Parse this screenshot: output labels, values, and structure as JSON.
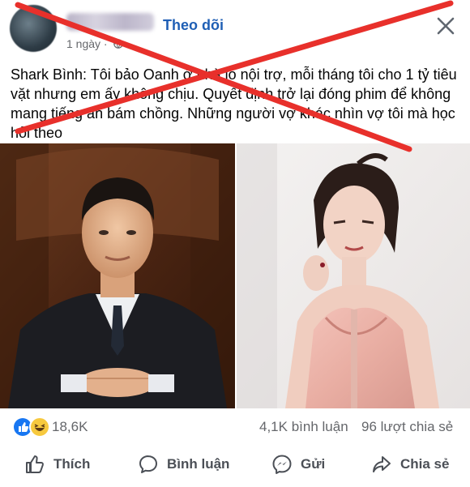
{
  "post": {
    "follow_label": "Theo dõi",
    "time_label": "1 ngày ·",
    "caption": "Shark Bình: Tôi bảo Oanh ở nhà lo nội trợ, mỗi tháng tôi cho 1 tỷ tiêu vặt nhưng em ấy không chịu. Quyết định trở lại đóng phim để không mang tiếng ăn bám chồng. Những người vợ khác nhìn vợ tôi mà học hỏi theo"
  },
  "stats": {
    "reaction_count": "18,6K",
    "comments": "4,1K bình luận",
    "shares": "96 lượt chia sẻ"
  },
  "actions": {
    "like": "Thích",
    "comment": "Bình luận",
    "send": "Gửi",
    "share": "Chia sẻ"
  },
  "icons": {
    "header": [
      "globe-icon",
      "close-icon"
    ],
    "reactions": [
      "like-reaction-icon",
      "haha-reaction-icon"
    ],
    "actions": [
      "thumbs-up-icon",
      "comment-bubble-icon",
      "messenger-icon",
      "share-arrow-icon"
    ]
  },
  "colors": {
    "follow_blue": "#1f5fb5",
    "strike_red": "#e8302b",
    "like_blue": "#1877f2",
    "haha_yellow": "#f7c93e",
    "muted_text": "#65676b"
  }
}
